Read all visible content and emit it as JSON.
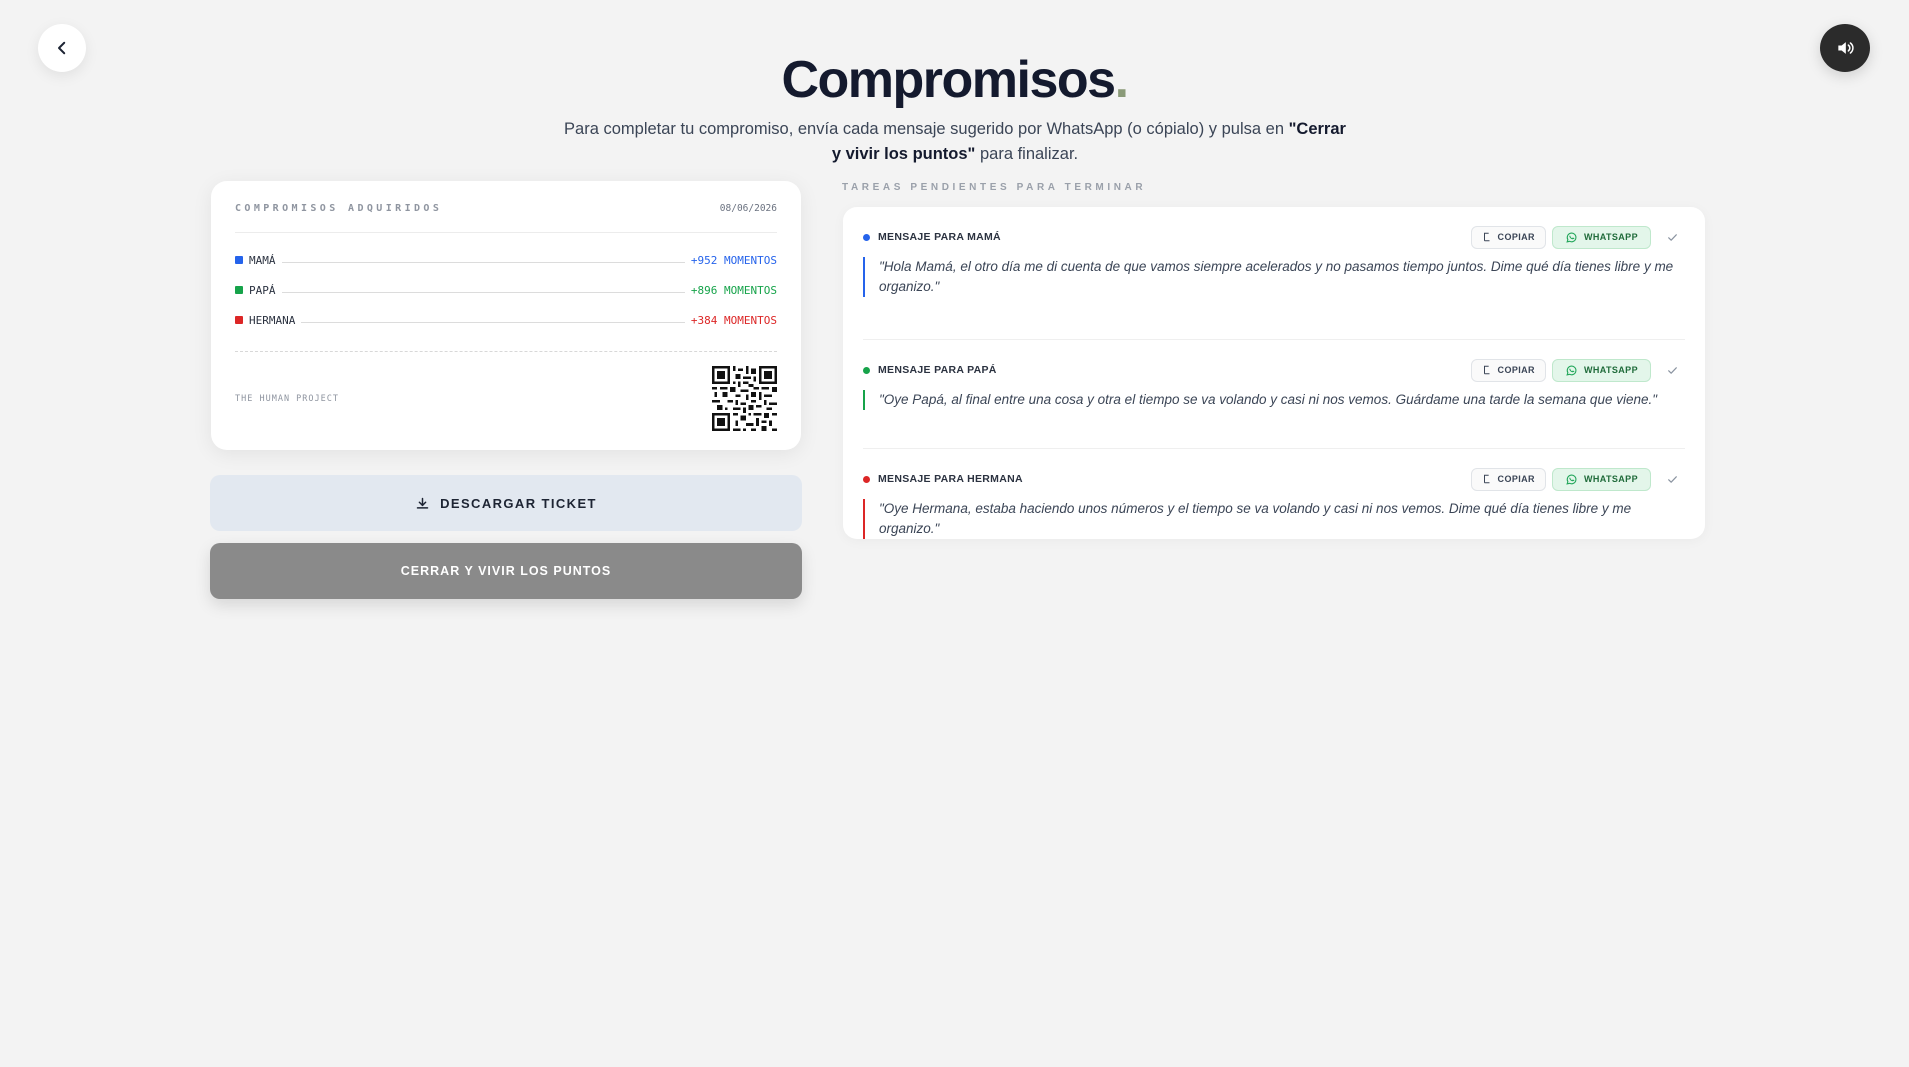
{
  "header": {
    "title": "Compromisos",
    "title_dot": ".",
    "subtitle_plain": "Para completar tu compromiso, envía cada mensaje sugerido por WhatsApp (o cópialo) y pulsa en ",
    "subtitle_bold": "\"Cerrar y vivir los puntos\"",
    "subtitle_end": " para finalizar."
  },
  "icons": {
    "back": "chevron-left-icon",
    "sound": "speaker-icon",
    "download": "download-icon",
    "copy": "copy-icon",
    "whatsapp": "whatsapp-icon",
    "check": "check-icon",
    "qr": "qr-code-icon"
  },
  "ticket": {
    "heading": "COMPROMISOS ADQUIRIDOS",
    "date": "08/06/2026",
    "rows": [
      {
        "name": "MAMÁ",
        "value": "+952 MOMENTOS",
        "color": "#2563eb"
      },
      {
        "name": "PAPÁ",
        "value": "+896 MOMENTOS",
        "color": "#16a34a"
      },
      {
        "name": "HERMANA",
        "value": "+384 MOMENTOS",
        "color": "#dc2626"
      }
    ],
    "brand": "THE HUMAN PROJECT"
  },
  "actions": {
    "download_label": "DESCARGAR TICKET",
    "close_label": "CERRAR Y VIVIR LOS PUNTOS"
  },
  "tasks": {
    "heading": "TAREAS PENDIENTES PARA TERMINAR",
    "copy_label": "COPIAR",
    "whatsapp_label": "WHATSAPP",
    "items": [
      {
        "label": "MENSAJE PARA MAMÁ",
        "color": "#2563eb",
        "message": "\"Hola Mamá, el otro día me di cuenta de que vamos siempre acelerados y no pasamos tiempo juntos. Dime qué día tienes libre y me organizo.\""
      },
      {
        "label": "MENSAJE PARA PAPÁ",
        "color": "#16a34a",
        "message": "\"Oye Papá, al final entre una cosa y otra el tiempo se va volando y casi ni nos vemos. Guárdame una tarde la semana que viene.\""
      },
      {
        "label": "MENSAJE PARA HERMANA",
        "color": "#dc2626",
        "message": "\"Oye Hermana, estaba haciendo unos números y el tiempo se va volando y casi ni nos vemos. Dime qué día tienes libre y me organizo.\""
      }
    ]
  }
}
